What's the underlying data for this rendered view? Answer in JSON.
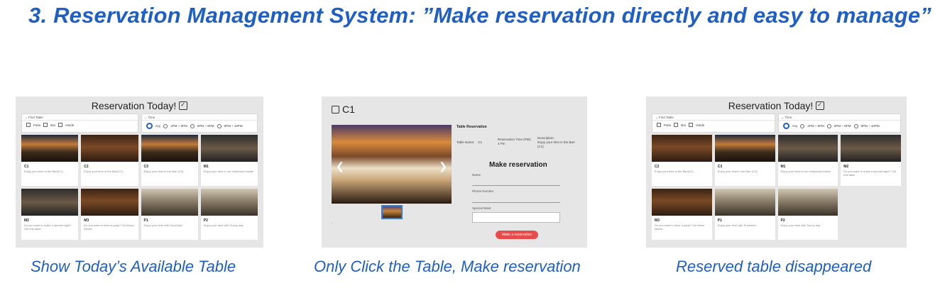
{
  "slide": {
    "title": "3. Reservation Management System: ”Make reservation directly and easy to manage”",
    "captions": {
      "left": "Show Today’s Available Table",
      "middle": "Only Click the Table, Make reservation",
      "right": "Reserved table disappeared"
    },
    "accent_color": "#1f5fc4"
  },
  "list_screen": {
    "header": "Reservation Today!",
    "header_icon": "calendar-check-icon",
    "find_table": {
      "label": "Find Table",
      "options": [
        "Patio",
        "Bar",
        "Inside"
      ]
    },
    "time": {
      "label": "Time",
      "options": [
        "Any",
        "4PM ~ 6PM",
        "6PM ~ 8PM",
        "8PM ~ 10PM"
      ],
      "selected": "Any"
    }
  },
  "left_cards": [
    {
      "name": "C1",
      "desc": "Enjoy your time in the Bar!(C1)"
    },
    {
      "name": "C2",
      "desc": "Enjoy your time in the Bar!(C2)"
    },
    {
      "name": "C3",
      "desc": "Enjoy your time in the Bar! (C3)"
    },
    {
      "name": "M1",
      "desc": "Enjoy your time in our restaurant inside!"
    },
    {
      "name": "M2",
      "desc": "Do you want to make a special night? Get this table"
    },
    {
      "name": "M3",
      "desc": "Do you want to have a party? Get these tables!"
    },
    {
      "name": "P1",
      "desc": "Enjoy your time with Sunshine!"
    },
    {
      "name": "P2",
      "desc": "Enjoy your time with Sunny day"
    }
  ],
  "right_cards": [
    {
      "name": "C2",
      "desc": "Enjoy your time in the Bar!(C2)"
    },
    {
      "name": "C3",
      "desc": "Enjoy your time in the Bar! (C3)"
    },
    {
      "name": "M1",
      "desc": "Enjoy your time in our restaurant inside!"
    },
    {
      "name": "M2",
      "desc": "Do you want to make a special night? Get this table"
    },
    {
      "name": "M3",
      "desc": "Do you want to have a party? Get these tables!"
    },
    {
      "name": "P1",
      "desc": "Enjoy your time with Sunshine!"
    },
    {
      "name": "P2",
      "desc": "Enjoy your time with Sunny day"
    }
  ],
  "detail_screen": {
    "title": "C1",
    "title_icon": "calendar-icon",
    "table_reservation_heading": "Table Reservation",
    "table_name_label": "Table Name:",
    "table_name_value": "C1",
    "reservation_time_label": "Reservation Time (PM):",
    "reservation_time_value": "4 Pm",
    "description_label": "Description:",
    "description_value": "Enjoy your time in the Bar! (C1)",
    "form_title": "Make reservation",
    "name_label": "Name",
    "phone_label": "Phone Number",
    "special_label": "Special Want",
    "submit_label": "Make a reservation",
    "prev_arrow": "❮",
    "next_arrow": "❯",
    "footer_mark": ":"
  }
}
